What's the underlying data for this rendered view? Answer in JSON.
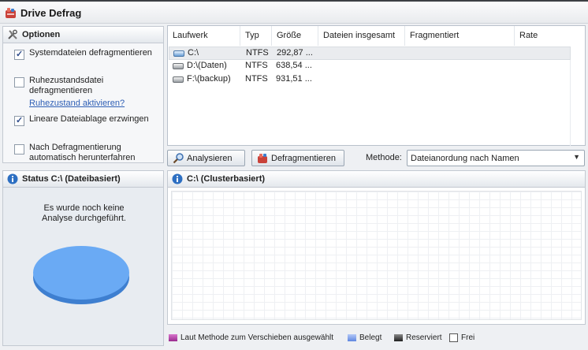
{
  "window": {
    "title": "Drive Defrag"
  },
  "options": {
    "header": "Optionen",
    "items": [
      {
        "label": "Systemdateien defragmentieren",
        "checked": true
      },
      {
        "label": "Ruhezustandsdatei defragmentieren",
        "checked": false,
        "link": "Ruhezustand aktivieren?"
      },
      {
        "label": "Lineare Dateiablage erzwingen",
        "checked": true
      },
      {
        "label": "Nach Defragmentierung automatisch herunterfahren",
        "checked": false
      }
    ]
  },
  "drives": {
    "columns": [
      "Laufwerk",
      "Typ",
      "Größe",
      "Dateien insgesamt",
      "Fragmentiert",
      "Rate"
    ],
    "rows": [
      {
        "name": "C:\\",
        "type": "NTFS",
        "size": "292,87 ...",
        "selected": true,
        "icon": "system-drive-icon"
      },
      {
        "name": "D:\\(Daten)",
        "type": "NTFS",
        "size": "638,54 ...",
        "selected": false,
        "icon": "hard-drive-icon"
      },
      {
        "name": "F:\\(backup)",
        "type": "NTFS",
        "size": "931,51 ...",
        "selected": false,
        "icon": "hard-drive-icon"
      }
    ]
  },
  "actions": {
    "analyze_label": "Analysieren",
    "defrag_label": "Defragmentieren",
    "method_label": "Methode:",
    "method_value": "Dateianordung nach Namen"
  },
  "status": {
    "header": "Status C:\\ (Dateibasiert)",
    "message_line1": "Es wurde noch keine",
    "message_line2": "Analyse durchgeführt.",
    "pie_color": "#6aaaf4"
  },
  "cluster": {
    "header": "C:\\ (Clusterbasiert)"
  },
  "legend": [
    {
      "label": "Laut Methode zum Verschieben ausgewählt",
      "color": "#b23aa6"
    },
    {
      "label": "Belegt",
      "color": "#7ea2ef"
    },
    {
      "label": "Reserviert",
      "color": "#3a3a3a"
    },
    {
      "label": "Frei",
      "color": "#ffffff"
    }
  ]
}
